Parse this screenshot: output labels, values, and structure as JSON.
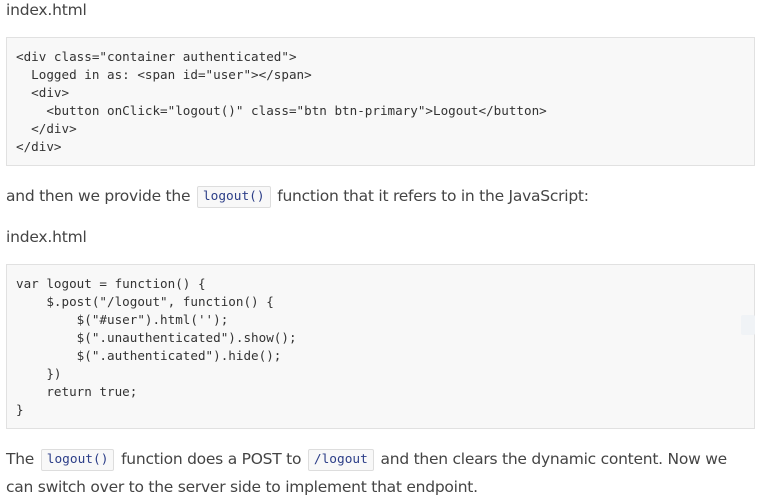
{
  "section1": {
    "file_label": "index.html",
    "code_lines": [
      "<div class=\"container authenticated\">",
      "  Logged in as: <span id=\"user\"></span>",
      "  <div>",
      "    <button onClick=\"logout()\" class=\"btn btn-primary\">Logout</button>",
      "  </div>",
      "</div>"
    ]
  },
  "para1": {
    "text_before": "and then we provide the ",
    "code": "logout()",
    "text_after": " function that it refers to in the JavaScript:"
  },
  "section2": {
    "file_label": "index.html",
    "code_lines": [
      "var logout = function() {",
      "    $.post(\"/logout\", function() {",
      "        $(\"#user\").html('');",
      "        $(\".unauthenticated\").show();",
      "        $(\".authenticated\").hide();",
      "    })",
      "    return true;",
      "}"
    ]
  },
  "para2": {
    "text_1": "The ",
    "code_1": "logout()",
    "text_2": " function does a POST to ",
    "code_2": "/logout",
    "text_3": " and then clears the dynamic content. Now we can switch over to the server side to implement that endpoint."
  }
}
